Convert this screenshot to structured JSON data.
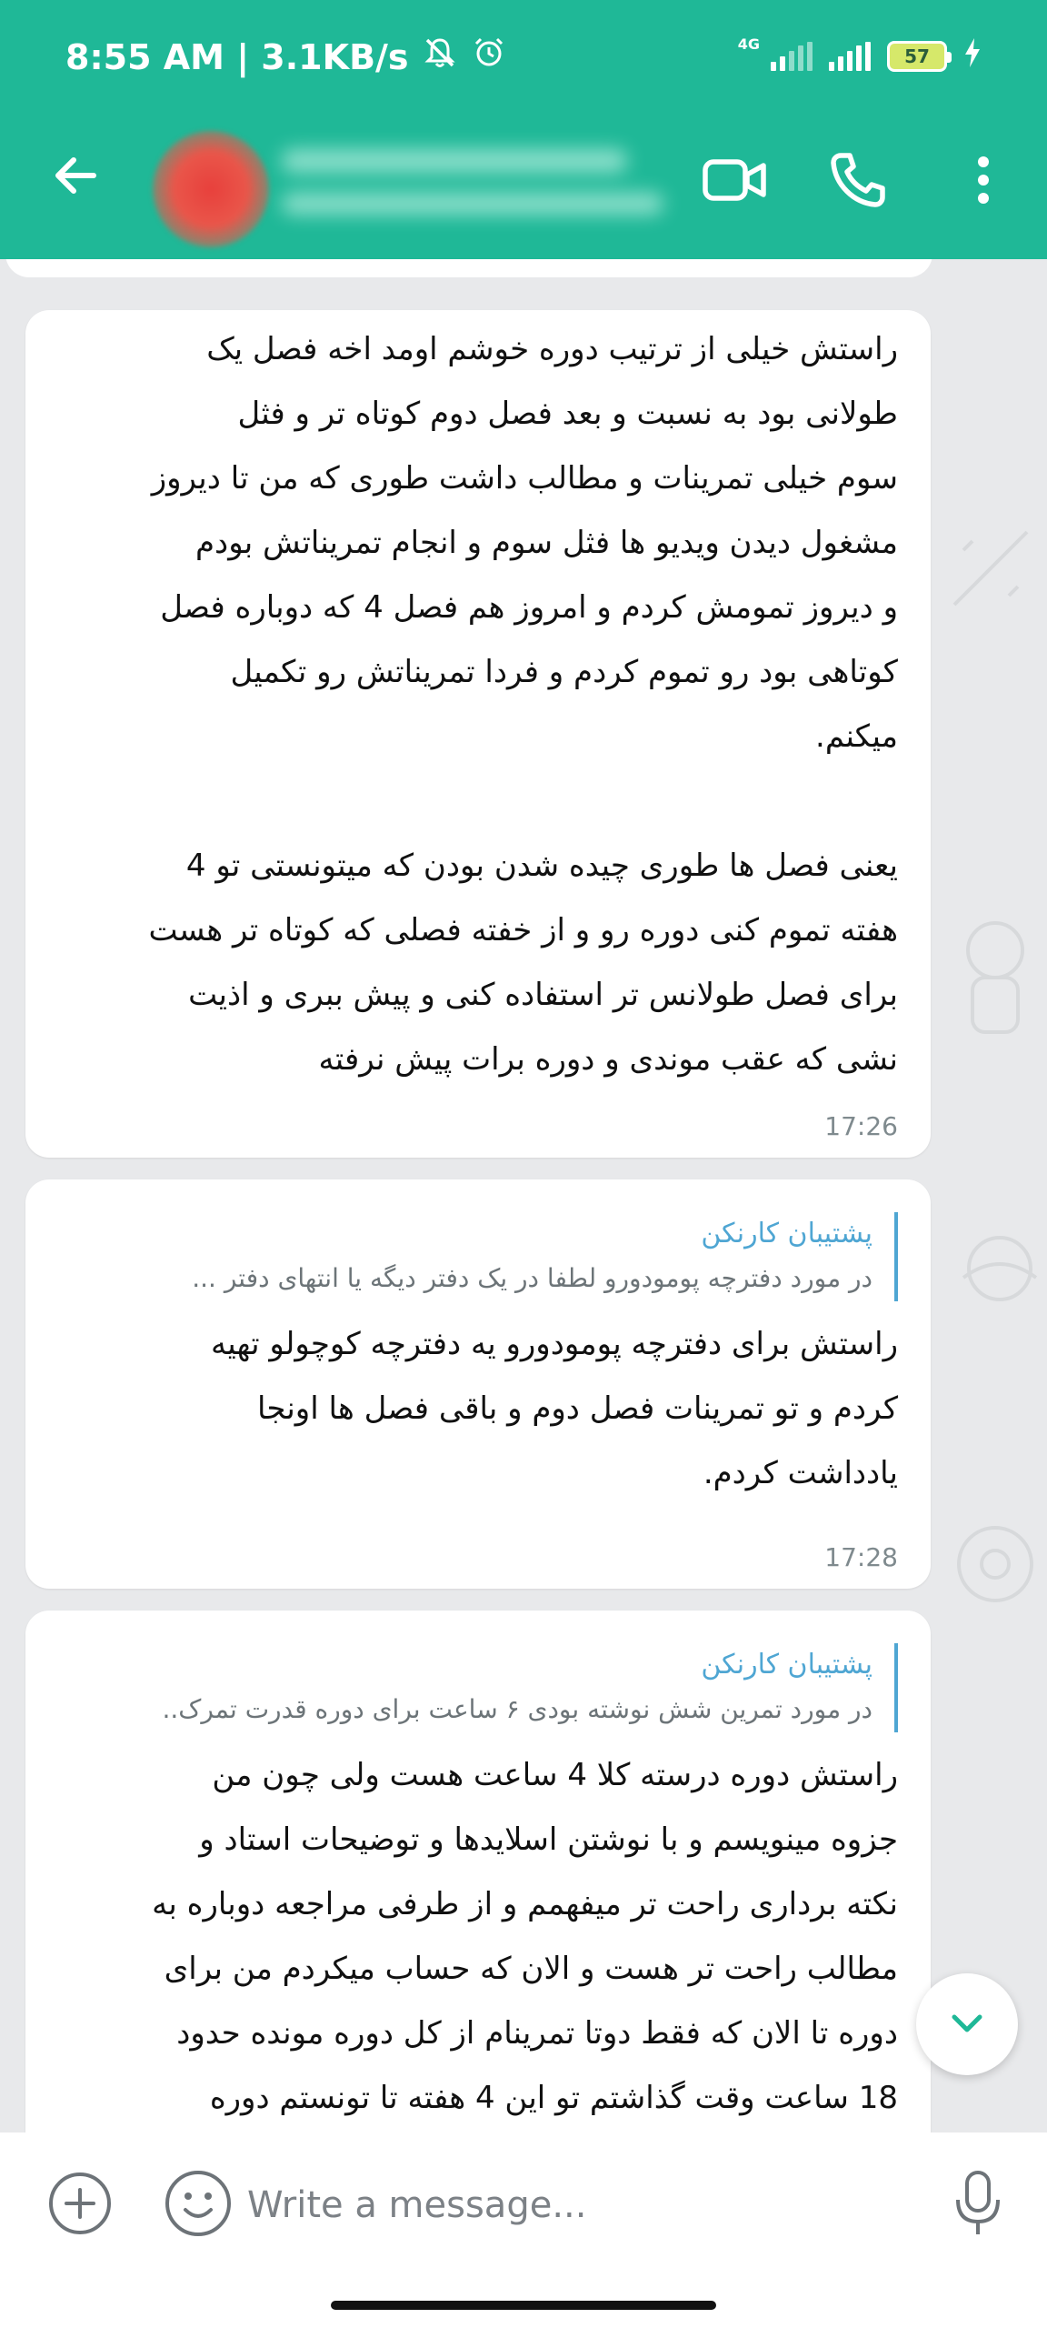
{
  "status_bar": {
    "time_speed": "8:55 AM | 3.1KB/s",
    "network": "4G",
    "battery": "57"
  },
  "header": {
    "icons": [
      "back-arrow-icon",
      "video-call-icon",
      "phone-call-icon",
      "more-vert-icon"
    ]
  },
  "messages": [
    {
      "text": "راستش خیلی از ترتیب دوره خوشم اومد اخه فصل یک\nطولانی بود به نسبت و بعد فصل دوم کوتاه تر و فثل\nسوم خیلی تمرینات و مطالب داشت طوری که من تا دیروز\nمشغول دیدن ویدیو ها فثل سوم و انجام تمریناتش بودم\nو دیروز تمومش کردم و امروز هم فصل 4 که دوباره فصل\nکوتاهی بود رو تموم کردم و فردا تمریناتش رو تکمیل\nمیکنم.\n\nیعنی فصل ها طوری چیده شدن بودن که میتونستی تو 4\nهفته تموم کنی دوره رو و از خفته فصلی که کوتاه تر هست\nبرای فصل طولانس تر استفاده کنی و پیش ببری و اذیت\nنشی که عقب موندی و دوره برات پیش نرفته",
      "time": "17:26"
    },
    {
      "reply_name": "پشتیبان کارنکن",
      "reply_text": "در مورد دفترچه پومودورو لطفا در یک دفتر دیگه یا انتهای دفتر ...",
      "text": "راستش برای دفترچه پومودورو یه دفترچه کوچولو تهیه\nکردم و تو تمرینات فصل دوم و باقی فصل ها اونجا\nیادداشت کردم.",
      "time": "17:28"
    },
    {
      "reply_name": "پشتیبان کارنکن",
      "reply_text": "در مورد تمرین شش نوشته بودی ۶ ساعت برای دوره قدرت تمرک..",
      "text": "راستش دوره درسته کلا 4 ساعت هست ولی چون من\nجزوه مینویسم و با نوشتن اسلایدها و توضیحات استاد و\nنکته برداری راحت تر میفهمم و از طرفی مراجعه دوباره به\nمطالب راحت تر هست و الان که حساب میکردم من برای\nدوره تا الان که فقط دوتا تمرینام از کل دوره مونده حدود\n18 ساعت وقت گذاشتم تو این 4 هفته تا تونستم دوره"
    }
  ],
  "composer": {
    "placeholder": "Write a message..."
  },
  "colors": {
    "header": "#1fb897",
    "reply_accent": "#4fa6d3",
    "scroll_chevron": "#1fb897"
  }
}
